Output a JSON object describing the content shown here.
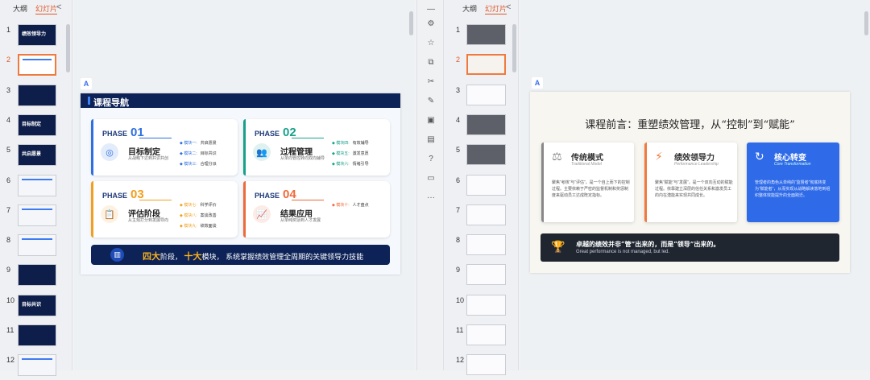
{
  "left_panel": {
    "tab_outline": "大纲",
    "tab_slides": "幻灯片",
    "close": "<",
    "slides": [
      {
        "n": "1"
      },
      {
        "n": "2"
      },
      {
        "n": "3"
      },
      {
        "n": "4"
      },
      {
        "n": "5"
      },
      {
        "n": "6"
      },
      {
        "n": "7"
      },
      {
        "n": "8"
      },
      {
        "n": "9"
      },
      {
        "n": "10"
      },
      {
        "n": "11"
      },
      {
        "n": "12"
      }
    ],
    "thumb_titles": {
      "t1": "绩效领导力",
      "t4": "目标制定",
      "t5": "共启愿景",
      "t10": "目标共识"
    }
  },
  "right_panel": {
    "tab_outline": "大纲",
    "tab_slides": "幻灯片",
    "close": "<",
    "slides": [
      {
        "n": "1"
      },
      {
        "n": "2"
      },
      {
        "n": "3"
      },
      {
        "n": "4"
      },
      {
        "n": "5"
      },
      {
        "n": "6"
      },
      {
        "n": "7"
      },
      {
        "n": "8"
      },
      {
        "n": "9"
      },
      {
        "n": "10"
      },
      {
        "n": "11"
      },
      {
        "n": "12"
      }
    ]
  },
  "slide1": {
    "title": "课程导航",
    "phase_label": "PHASE",
    "cards": [
      {
        "num": "01",
        "title": "目标制定",
        "sub": "从战略下达到共识共创",
        "mods": [
          [
            "模块一:",
            "共启愿景"
          ],
          [
            "模块二:",
            "目标共识"
          ],
          [
            "模块三:",
            "合理分派"
          ]
        ],
        "icon": "◎",
        "color": "#2f6fe0"
      },
      {
        "num": "02",
        "title": "过程管理",
        "sub": "从单向管控转向双向辅导",
        "mods": [
          [
            "模块四:",
            "有效辅导"
          ],
          [
            "模块五:",
            "激发意愿"
          ],
          [
            "模块六:",
            "情绪引导"
          ]
        ],
        "icon": "👥",
        "color": "#19a08a"
      },
      {
        "num": "03",
        "title": "评估阶段",
        "sub": "从主观打分到发展导向",
        "mods": [
          [
            "模块七:",
            "科学评价"
          ],
          [
            "模块八:",
            "案谈改善"
          ],
          [
            "模块九:",
            "绩效面谈"
          ]
        ],
        "icon": "📋",
        "color": "#f0a020"
      },
      {
        "num": "04",
        "title": "结果应用",
        "sub": "从单纯奖惩到人才发展",
        "mods": [
          [
            "模块十:",
            "人才盘点"
          ]
        ],
        "icon": "📈",
        "color": "#ee6a3a"
      }
    ],
    "bottom": {
      "hl1": "四大",
      "t1": "阶段，",
      "hl2": "十大",
      "t2": "模块，",
      "t3": "系统掌握绩效管理全周期的关键领导力技能"
    }
  },
  "slide2": {
    "title": "课程前言：重塑绩效管理，从“控制”到“赋能”",
    "cards": [
      {
        "title": "传统模式",
        "en": "Traditional Model",
        "desc": "聚焦“考核”与“评估”，是一个自上而下的控制过程。主要依赖于严密的监督机制和奖惩制度来驱动员工达成既定指标。",
        "icon": "⚖"
      },
      {
        "title": "绩效领导力",
        "en": "Performance Leadership",
        "desc": "聚焦“赋能”与“发展”，是一个双向互动的赋能过程。依靠建立深层的信任关系和激发员工的内在潜能来实现共同成长。",
        "icon": "⚡"
      },
      {
        "title": "核心转变",
        "en": "Core Transformation",
        "desc": "管理者的角色从单纯的“监督者”彻底转变为“赋能者”，从而实现从战略解读落地到组织整体效能提升的全面跨迁。",
        "icon": "↻"
      }
    ],
    "quote_zh": "卓越的绩效并非“管”出来的，而是“领导”出来的。",
    "quote_en": "Great performance is not managed, but led."
  },
  "logo": "A"
}
